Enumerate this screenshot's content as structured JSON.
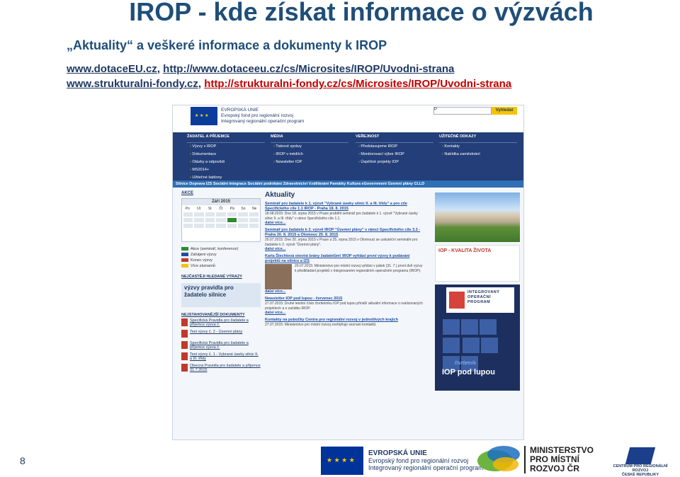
{
  "slide": {
    "title": "IROP - kde získat informace o výzvách",
    "subtitle": "„Aktuality“ a veškeré informace a dokumenty k IROP",
    "links": [
      {
        "site": "www.dotaceEU.cz",
        "sep": ", ",
        "url": "http://www.dotaceeu.cz/cs/Microsites/IROP/Uvodni-strana"
      },
      {
        "site": "www.strukturalni-fondy.cz",
        "sep": ", ",
        "url": "http://strukturalni-fondy.cz/cs/Microsites/IROP/Uvodni-strana"
      }
    ],
    "page_number": "8"
  },
  "web": {
    "header_lines": [
      "EVROPSKÁ UNIE",
      "Evropský fond pro regionální rozvoj",
      "Integrovaný regionální operační program"
    ],
    "search_placeholder": "P",
    "search_button": "Vyhledat",
    "menu": [
      {
        "heading": "ŽADATEL A PŘÍJEMCE",
        "items": [
          "Výzvy v IROP",
          "Dokumentace",
          "Otázky a odpovědi",
          "MS2014+",
          "Užitečné šablony"
        ]
      },
      {
        "heading": "MÉDIA",
        "items": [
          "Tiskové zprávy",
          "IROP v médiích",
          "Newsletter IOP"
        ]
      },
      {
        "heading": "VEŘEJNOST",
        "items": [
          "Představujeme IROP",
          "Monitorovací výbor IROP",
          "Úspěšné projekty IOP"
        ]
      },
      {
        "heading": "UŽITEČNÉ ODKAZY",
        "items": [
          "Kontakty",
          "Nabídka zaměstnání"
        ]
      }
    ],
    "strip": "Silnice   Doprava   IZS   Sociální integrace   Sociální podnikání   Zdravotnictví   Vzdělávání   Památky   Kultura   eGovernment   Územní plány   CLLD",
    "akce": "AKCE",
    "calendar_month": "Září 2015",
    "calendar_days": [
      "Po",
      "Út",
      "St",
      "Čt",
      "Pá",
      "So",
      "Ne"
    ],
    "legend": [
      {
        "label": "Akce (seminář, konference)",
        "color": "#2e8b2e"
      },
      {
        "label": "Zahájení výzvy",
        "color": "#1f4e9c"
      },
      {
        "label": "Konec výzvy",
        "color": "#c0392b"
      },
      {
        "label": "Více záznamů",
        "color": "#f4c400"
      }
    ],
    "faq_title": "NEJČASTĚJI HLEDANÉ VÝRAZY",
    "promo": "výzvy pravidla pro žadatelo silnice",
    "docs_title": "NEJSTAHOVANĚJŠÍ DOKUMENTY",
    "docs": [
      "Specifická Pravidla pro žadatele a příjemce výzva č.",
      "Text výzvy č. 2 - Územní plány",
      "Specifická Pravidla pro žadatele a příjemce výzva č.",
      "Text výzvy č. 1 - Vybrané úseky silnic II. a III. třídy",
      "Obecná Pravidla pro žadatele a příjemce 31.7.2015"
    ],
    "aktuality_title": "Aktuality",
    "news": [
      {
        "title": "Seminář pro žadatele k 1. výzvě \"Vybrané úseky silnic II. a III. třídy\" a pro cíle Specifického cíle 1.1 IROP - Praha 18. 8. 2015",
        "body": "18.08.2015: Dne 18. srpna 2015 v Praze proběhl seminář pro žadatele k 1. výzvě \"Vybrané úseky silnic II. a III. třídy\" v rámci Specifického cíle 1.1.",
        "more": "dalsi více..."
      },
      {
        "title": "Seminář pro žadatele k 2. výzvě IROP \"Územní plány\" v rámci Specifického cíle 3.3 - Praha 20. 8. 2015 a Olomouc 25. 8. 2015",
        "body": "20.07.2015: Dne 20. srpna 2015 v Praze a 25. srpna 2015 v Olomouci se uskuteční semináře pro žadatele k 2. výzvě \"Územní plány\".",
        "more": "dalsi více..."
      },
      {
        "title": "Karla Šlechtová otevírá brány žadatelům! IROP vyhlásí první výzvy k podávání projektů na silnice a IZS",
        "body": "29.07.2015: Ministerstvo pro místní rozvoj vyhlásí v pátek (31. 7.) první dvě výzvy k předkládání projektů v Integrovaném regionálním operačním programu (IROP).",
        "more": "dalsi více..."
      },
      {
        "title": "Newsletter IOP pod lupou - červenec 2015",
        "body": "27.07.2015: Druhé letošní číslo čtvrtletníku IOP pod lupou přináší aktuální informace o realizovaných projektech a o začátku IROP.",
        "more": "dalsi více..."
      },
      {
        "title": "Kontakty na pobočky Centra pro regionální rozvoj v jednotlivých krajích",
        "body": "27.07.2015: Ministerstvo pro místní rozvoj zveřejňuje seznam kontaktů.",
        "more": ""
      }
    ],
    "kvalita": "IOP - KVALITA ŽIVOTA",
    "irop_logo": [
      "INTEGROVANÝ",
      "OPERAČNÍ",
      "PROGRAM"
    ],
    "ctvrtletnik": "čtvrtletník",
    "iop_pod_lupou": "IOP pod lupou"
  },
  "footer": {
    "eu_lines": [
      "EVROPSKÁ UNIE",
      "Evropský fond pro regionální rozvoj",
      "Integrovaný regionální operační program"
    ],
    "mmr_lines": [
      "MINISTERSTVO",
      "PRO MÍSTNÍ",
      "ROZVOJ ČR"
    ],
    "crr_lines": [
      "CENTRUM PRO REGIONÁLNÍ ROZVOJ",
      "ČESKÉ REPUBLIKY"
    ]
  }
}
